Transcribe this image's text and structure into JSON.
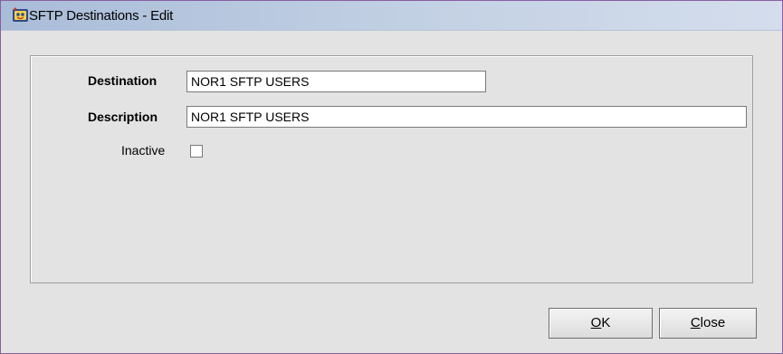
{
  "window": {
    "title": "SFTP Destinations - Edit",
    "icon": "opera-app-icon"
  },
  "form": {
    "destination": {
      "label": "Destination",
      "value": "NOR1 SFTP USERS"
    },
    "description": {
      "label": "Description",
      "value": "NOR1 SFTP USERS"
    },
    "inactive": {
      "label": "Inactive",
      "checked": false
    }
  },
  "buttons": {
    "ok": {
      "mnemonic": "O",
      "rest": "K"
    },
    "close": {
      "mnemonic": "C",
      "rest": "lose"
    }
  },
  "colors": {
    "window_border": "#8a5fa0",
    "titlebar_start": "#a9bcd8",
    "titlebar_end": "#d4ddec",
    "background": "#e3e3e3"
  }
}
